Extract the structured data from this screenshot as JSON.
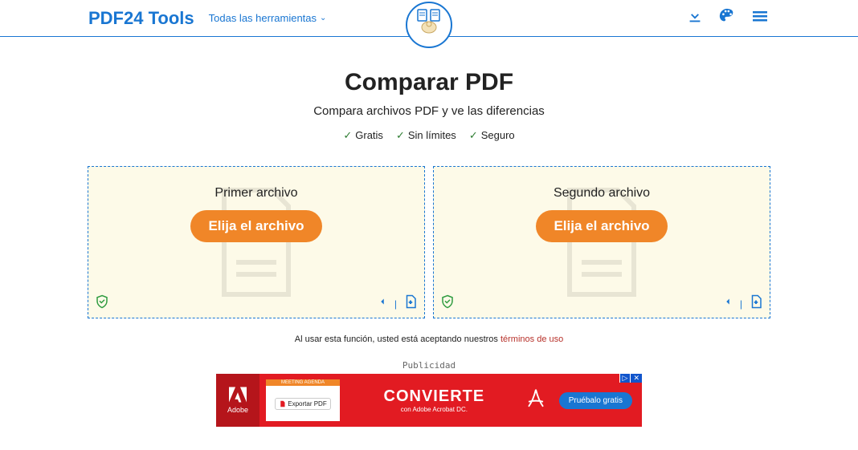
{
  "header": {
    "logo": "PDF24 Tools",
    "nav_all_tools": "Todas las herramientas"
  },
  "page": {
    "title": "Comparar PDF",
    "subtitle": "Compara archivos PDF y ve las diferencias",
    "features": [
      "Gratis",
      "Sin límites",
      "Seguro"
    ]
  },
  "dropzones": [
    {
      "title": "Primer archivo",
      "button": "Elija el archivo"
    },
    {
      "title": "Segundo archivo",
      "button": "Elija el archivo"
    }
  ],
  "terms": {
    "prefix": "Al usar esta función, usted está aceptando nuestros ",
    "link": "términos de uso"
  },
  "ad": {
    "label": "Publicidad",
    "brand": "Adobe",
    "doc_header": "MEETING AGENDA",
    "export": "Exportar PDF",
    "title": "CONVIERTE",
    "subtitle": "con Adobe Acrobat DC.",
    "cta": "Pruébalo gratis",
    "close": "✕"
  }
}
